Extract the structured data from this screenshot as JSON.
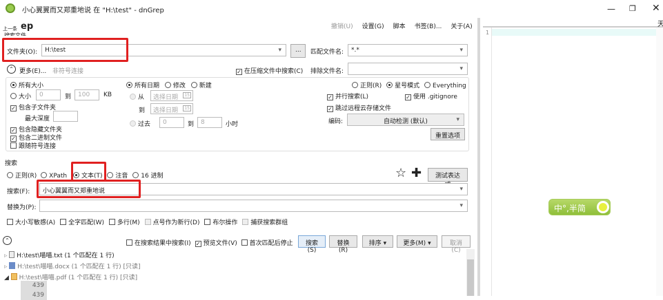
{
  "title": "小心翼翼而又郑重地说 在 \"H:\\test\" - dnGrep",
  "header": {
    "prev": "上一条",
    "app_partial": "ep",
    "subtitle": "搜索文件"
  },
  "menu": {
    "undo": "撤销(U)",
    "settings": "设置(G)",
    "script": "脚本",
    "bookmarks": "书签(B)...",
    "about": "关于(A)"
  },
  "folder": {
    "label": "文件夹(O):",
    "value": "H:\\test",
    "browse": "..."
  },
  "pattern": {
    "label": "匹配文件名:",
    "value": "*.*",
    "exclude_label": "排除文件名:",
    "exclude_value": ""
  },
  "more": {
    "label": "更多(E)...",
    "hint": "非符号连接",
    "archive": "在压缩文件中搜索(C)"
  },
  "size": {
    "all": "所有大小",
    "size": "大小",
    "from": "0",
    "to_label": "到",
    "to": "100",
    "unit": "KB",
    "subfolders": "包含子文件夹",
    "max_depth": "最大深度",
    "hidden": "包含隐藏文件夹",
    "binary": "包含二进制文件",
    "symlinks": "跟随符号连接"
  },
  "date": {
    "all": "所有日期",
    "modified": "修改",
    "created": "新建",
    "from": "从",
    "to": "到",
    "placeholder": "选择日期",
    "cal": "15",
    "past": "过去",
    "past_from": "0",
    "past_to_label": "到",
    "past_to": "8",
    "hours": "小时"
  },
  "filemode": {
    "regex": "正则(R)",
    "glob": "星号模式",
    "everything": "Everything",
    "parallel": "并行搜索(L)",
    "gitignore": "使用 .gitignore",
    "skip_cloud": "跳过远程云存储文件",
    "encoding_label": "编码:",
    "encoding": "自动检测 (默认)",
    "reset": "重置选项"
  },
  "search": {
    "section": "搜索",
    "modes": [
      "正则(R)",
      "XPath",
      "文本(T)",
      "注音",
      "16 进制"
    ],
    "test": "测试表达式",
    "label": "搜索(F):",
    "value": "小心翼翼而又郑重地说",
    "replace_label": "替换为(P):",
    "replace_value": "",
    "opts": [
      "大小写敏感(A)",
      "全字匹配(W)",
      "多行(M)",
      "点号作为新行(D)",
      "布尔操作",
      "捕获搜索群组"
    ]
  },
  "actions": {
    "in_results": "在搜索结果中搜索(I)",
    "preview": "预览文件(V)",
    "stop_first": "首次匹配后停止",
    "search": "搜索(S)",
    "replace": "替换(R)",
    "sort": "排序",
    "more": "更多(M)",
    "cancel": "取消(C)"
  },
  "results": [
    {
      "name": "H:\\test\\喵喵.txt (1 个匹配在 1 行)"
    },
    {
      "name": "H:\\test\\喵喵.docx (1 个匹配在 1 行) [只读]"
    },
    {
      "name": "H:\\test\\喵喵.pdf (1 个匹配在 1 行) [只读]"
    }
  ],
  "lines": [
    "439",
    "439"
  ],
  "preview": {
    "line": "1",
    "corner": "天"
  },
  "ime": {
    "text": "中°,半简"
  }
}
